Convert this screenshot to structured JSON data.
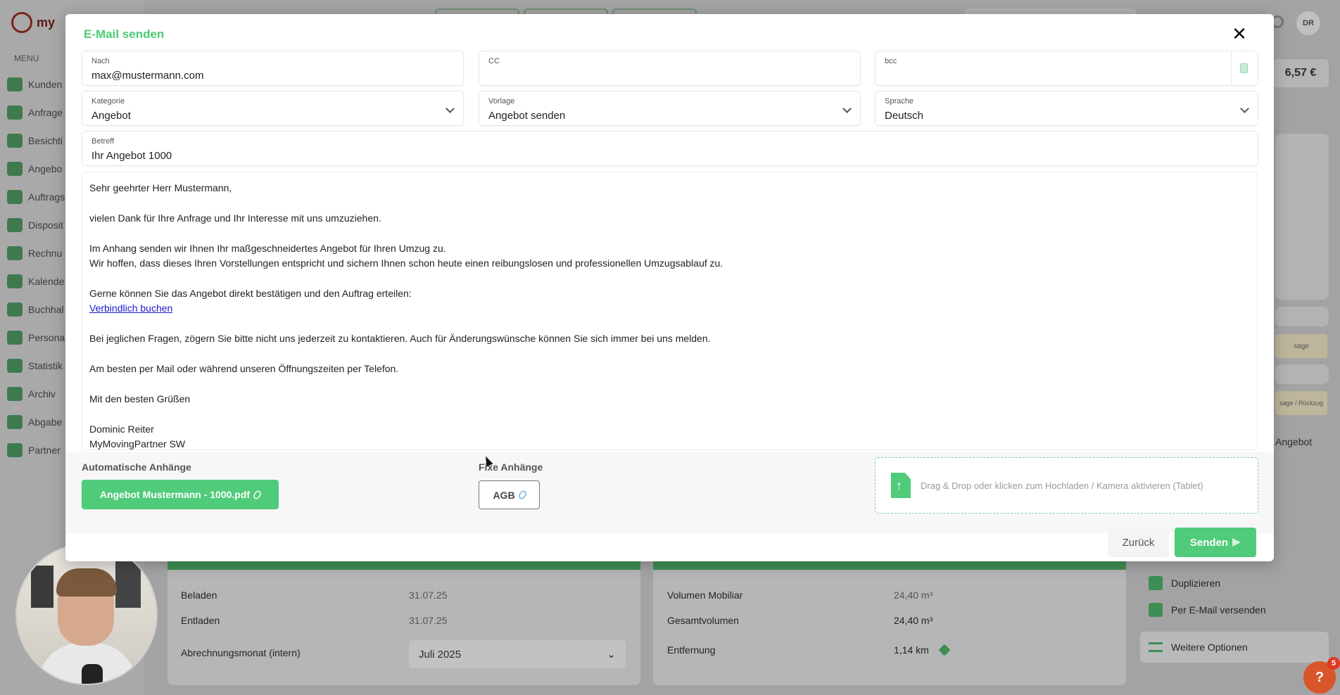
{
  "background": {
    "logo_text": "my",
    "menu_label": "MENU",
    "menu_items": [
      "Kunden",
      "Anfrage",
      "Besichti",
      "Angebo",
      "Auftrags",
      "Disposit",
      "Rechnu",
      "Kalende",
      "Buchhal",
      "Persona",
      "Statistik",
      "Archiv",
      "Abgabe",
      "Partner"
    ],
    "user_initials": "DR",
    "amount": "6,57 €",
    "badge_1": "sage",
    "badge_2": "sage / Rückzug",
    "angebot_label": "Angebot",
    "left_rows": [
      {
        "label": "Beladen",
        "value": "31.07.25"
      },
      {
        "label": "Entladen",
        "value": "31.07.25"
      },
      {
        "label": "Abrechnungsmonat (intern)",
        "value": "Juli 2025"
      }
    ],
    "right_rows": [
      {
        "label": "Volumen Mobiliar",
        "value": "24,40 m³"
      },
      {
        "label": "Gesamtvolumen",
        "value": "24,40 m³"
      },
      {
        "label": "Entfernung",
        "value": "1,14 km"
      }
    ],
    "actions": [
      "Duplizieren",
      "Per E-Mail versenden"
    ],
    "more_options": "Weitere Optionen",
    "help_symbol": "?",
    "help_count": "5"
  },
  "modal": {
    "title": "E-Mail senden",
    "close_symbol": "✕",
    "fields": {
      "to": {
        "label": "Nach",
        "value": "max@mustermann.com"
      },
      "cc": {
        "label": "CC",
        "value": ""
      },
      "bcc": {
        "label": "bcc",
        "value": ""
      },
      "category": {
        "label": "Kategorie",
        "value": "Angebot"
      },
      "template": {
        "label": "Vorlage",
        "value": "Angebot senden"
      },
      "language": {
        "label": "Sprache",
        "value": "Deutsch"
      },
      "subject": {
        "label": "Betreff",
        "value": "Ihr Angebot 1000"
      }
    },
    "body": {
      "greeting": "Sehr geehrter Herr Mustermann,",
      "line_thanks": "vielen Dank für Ihre Anfrage und Ihr Interesse mit uns umzuziehen.",
      "line_attach": "Im Anhang senden wir Ihnen Ihr maßgeschneidertes Angebot für Ihren Umzug zu.",
      "line_hope": "Wir hoffen, dass dieses Ihren Vorstellungen entspricht und sichern Ihnen schon heute einen reibungslosen und professionellen Umzugsablauf zu.",
      "line_confirm": "Gerne können Sie das Angebot direkt bestätigen und den Auftrag erteilen:",
      "link_book": "Verbindlich buchen",
      "line_questions": "Bei jeglichen Fragen, zögern Sie bitte nicht uns jederzeit zu kontaktieren. Auch für Änderungswünsche können Sie sich immer bei uns melden.",
      "line_best": "Am besten per Mail oder während unseren Öffnungszeiten per Telefon.",
      "closing": "Mit den besten Grüßen",
      "signature_name": "Dominic Reiter",
      "signature_company": "MyMovingPartner SW"
    },
    "attachments": {
      "auto_label": "Automatische Anhänge",
      "auto_file": "Angebot Mustermann - 1000.pdf",
      "fixed_label": "Fixe Anhänge",
      "fixed_file": "AGB",
      "dropzone_text": "Drag & Drop oder klicken zum Hochladen / Kamera aktivieren (Tablet)"
    },
    "buttons": {
      "back": "Zurück",
      "send": "Senden"
    }
  },
  "colors": {
    "accent_green": "#4fcb7a",
    "link_blue": "#1a1acc",
    "help_orange": "#d9552a"
  }
}
